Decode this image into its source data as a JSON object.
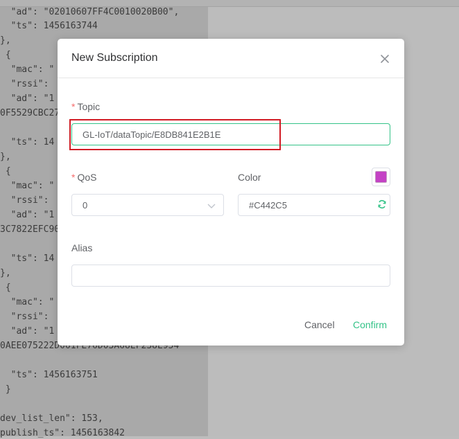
{
  "background_json": {
    "lines": [
      "  \"ad\": \"02010607FF4C0010020B00\",",
      "  \"ts\": 1456163744",
      "},",
      " {",
      "  \"mac\": \"",
      "  \"rssi\":",
      "  \"ad\": \"1",
      "0F5529CBC27",
      "  \"ts\": 14",
      "},",
      " {",
      "  \"mac\": \"",
      "  \"rssi\":",
      "  \"ad\": \"1",
      "3C7822EFC90",
      "  \"ts\": 14",
      "},",
      " {",
      "  \"mac\": \"",
      "  \"rssi\":",
      "  \"ad\": \"1",
      "0AEE075222D061FE76D03A68EF238E954",
      "  \"ts\": 1456163751",
      " }",
      "dev_list_len\": 153,",
      "publish_ts\": 1456163842"
    ]
  },
  "dialog": {
    "title": "New Subscription",
    "close_icon": "close-icon",
    "topic": {
      "label": "Topic",
      "required_mark": "*",
      "value": "GL-IoT/dataTopic/E8DB841E2B1E"
    },
    "qos": {
      "label": "QoS",
      "required_mark": "*",
      "value": "0"
    },
    "color": {
      "label": "Color",
      "value": "#C442C5",
      "swatch_color": "#C442C5"
    },
    "alias": {
      "label": "Alias",
      "value": ""
    },
    "cancel_label": "Cancel",
    "confirm_label": "Confirm"
  },
  "colors": {
    "accent": "#34C388",
    "required": "#F56C6C",
    "highlight": "#D11B24"
  }
}
